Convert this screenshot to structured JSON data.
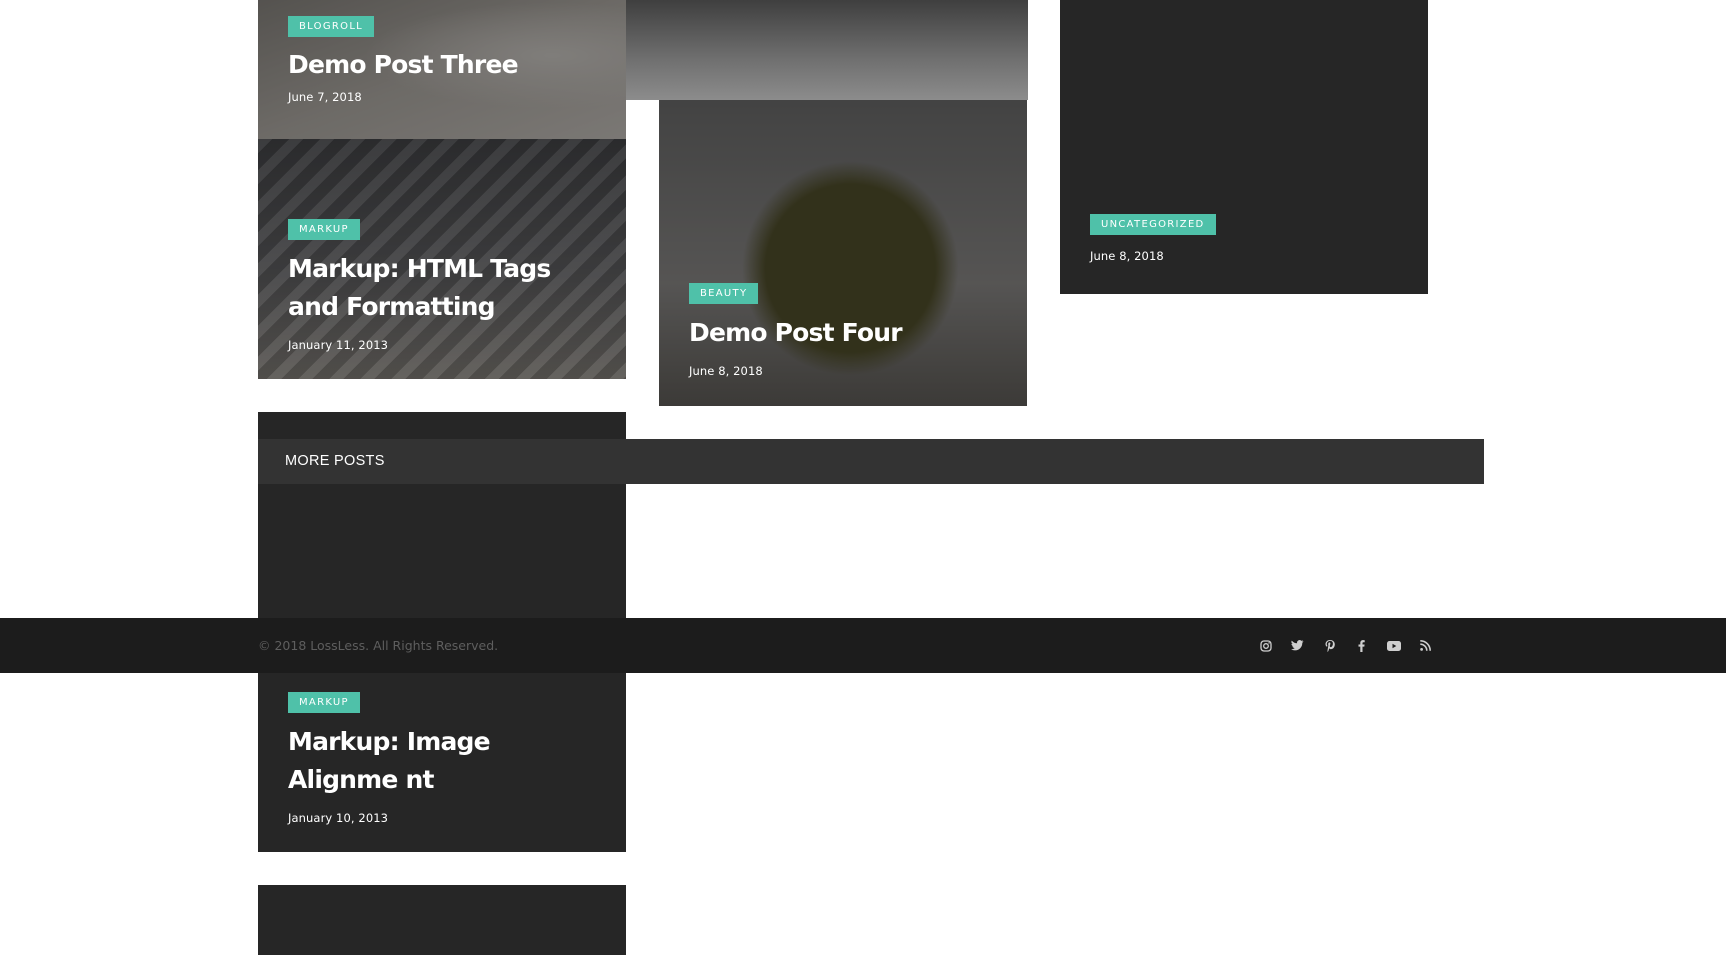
{
  "posts": [
    {
      "category": "Blogroll",
      "title": "Demo Post Three",
      "date": "June 7, 2018"
    },
    {
      "category": "Markup",
      "title": "Markup: HTML Tags and Formatting",
      "date": "January 11, 2013"
    },
    {
      "category": "Beauty",
      "title": "Demo Post Four",
      "date": "June 8, 2018"
    },
    {
      "category": "Uncategorized",
      "title": "",
      "date": "June 8, 2018"
    },
    {
      "category": "Markup",
      "title": "Markup: Image Alignme nt",
      "date": "January 10, 2013"
    }
  ],
  "more_posts": {
    "label": "MORE POSTS"
  },
  "footer": {
    "copyright": "© 2018 LossLess. All Rights Reserved.",
    "socials": [
      "instagram-icon",
      "twitter-icon",
      "pinterest-icon",
      "facebook-icon",
      "youtube-icon",
      "rss-icon"
    ]
  },
  "colors": {
    "accent": "#4fc1a9",
    "card_dark": "#262626",
    "bar": "#333333",
    "footer_bg": "#1c1c1c"
  }
}
